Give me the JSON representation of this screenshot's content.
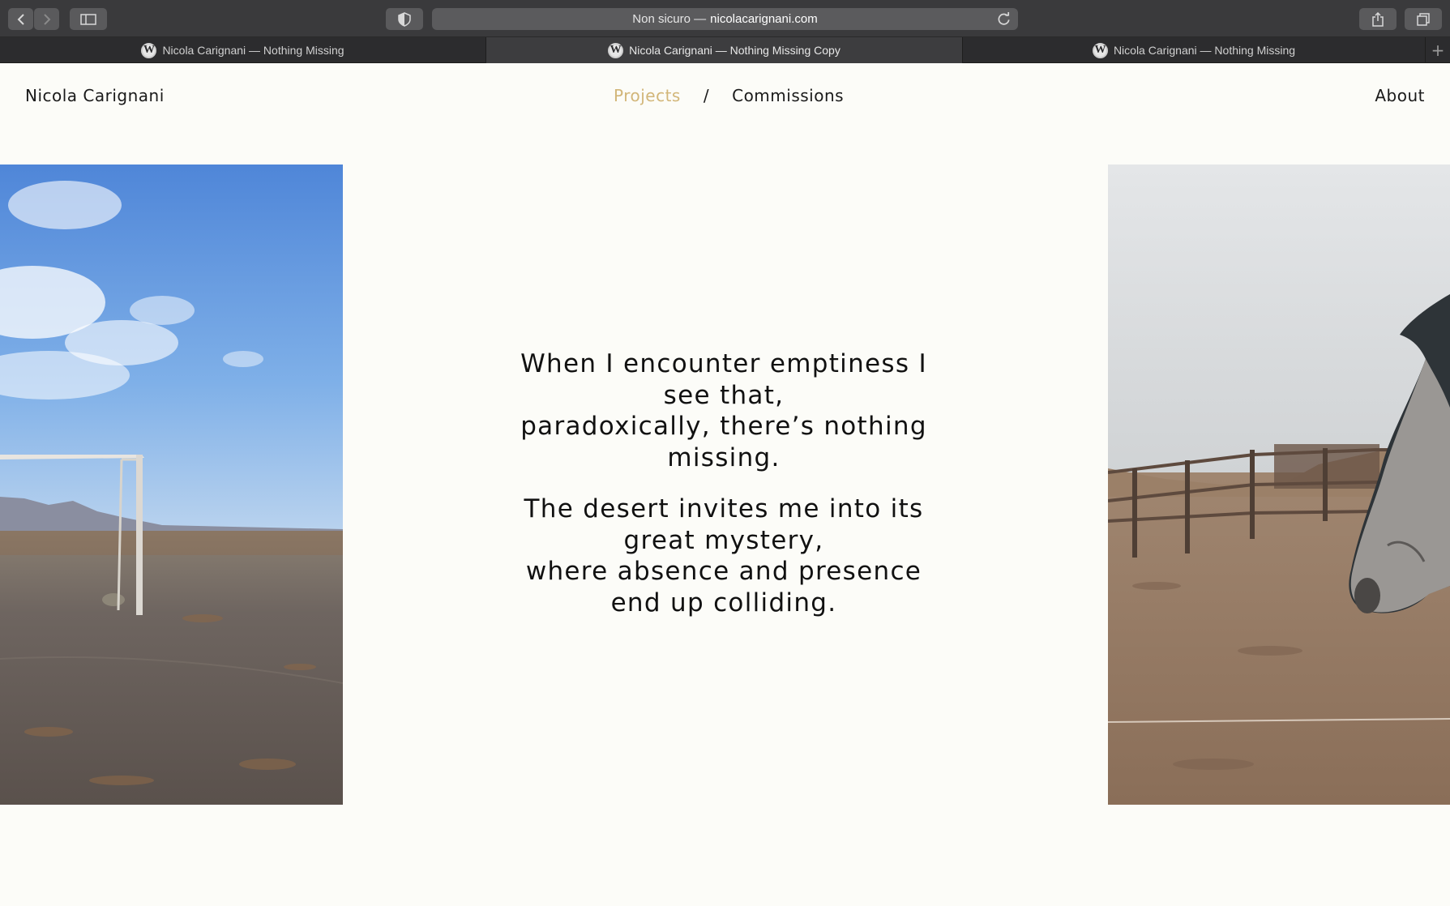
{
  "browser": {
    "address_prefix": "Non sicuro —",
    "address_host": "nicolacarignani.com",
    "tabs": [
      {
        "title": "Nicola Carignani — Nothing Missing",
        "active": false
      },
      {
        "title": "Nicola Carignani — Nothing Missing Copy",
        "active": true
      },
      {
        "title": "Nicola Carignani — Nothing Missing",
        "active": false
      }
    ]
  },
  "site": {
    "name": "Nicola Carignani",
    "nav": {
      "projects": "Projects",
      "separator": "/",
      "commissions": "Commissions",
      "about": "About"
    },
    "accent_color": "#d2b679"
  },
  "quote": {
    "lines_1": [
      "When I encounter emptiness I",
      "see that,",
      "paradoxically, there’s nothing",
      "missing."
    ],
    "lines_2": [
      "The desert invites me into its",
      "great mystery,",
      "where absence and presence",
      "end up colliding."
    ]
  }
}
